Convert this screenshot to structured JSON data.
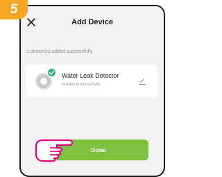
{
  "step_badge": "5",
  "header": {
    "title": "Add Device"
  },
  "success_note": "1 device(s) added successfully",
  "device": {
    "name": "Water Leak Detector",
    "status": "Added successfully"
  },
  "done_label": "Done",
  "colors": {
    "accent_green": "#7fc241",
    "badge_orange": "#f5a623",
    "check_green": "#2bb673"
  },
  "icons": [
    "close-icon",
    "check-icon",
    "edit-icon",
    "pointing-hand-icon"
  ]
}
